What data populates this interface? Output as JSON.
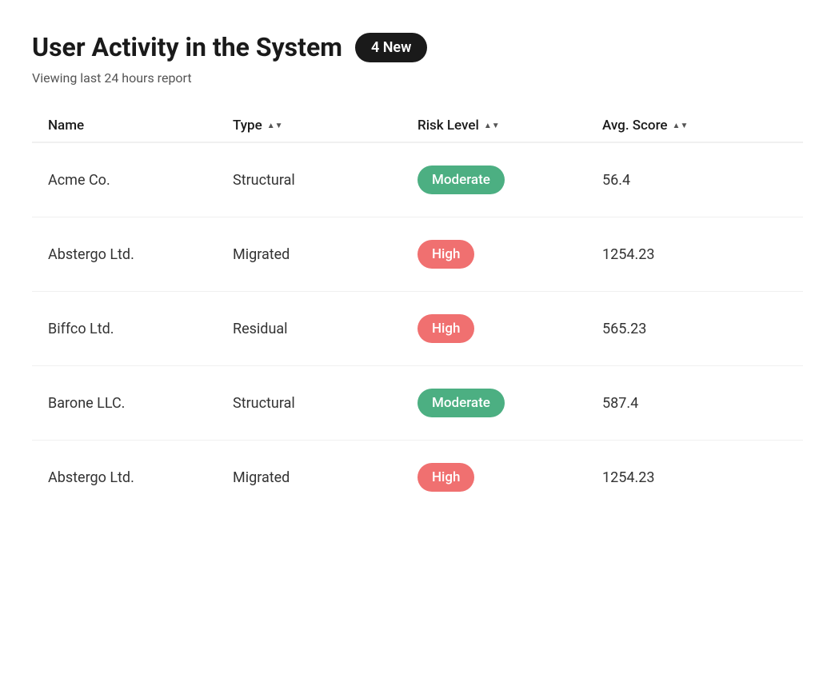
{
  "header": {
    "title": "User Activity in the System",
    "badge": "4 New",
    "subtitle": "Viewing last 24 hours report"
  },
  "table": {
    "columns": [
      {
        "label": "Name",
        "sortable": false
      },
      {
        "label": "Type",
        "sortable": true
      },
      {
        "label": "Risk Level",
        "sortable": true
      },
      {
        "label": "Avg. Score",
        "sortable": true
      }
    ],
    "rows": [
      {
        "name": "Acme Co.",
        "type": "Structural",
        "risk": "Moderate",
        "risk_class": "badge-moderate",
        "score": "56.4"
      },
      {
        "name": "Abstergo Ltd.",
        "type": "Migrated",
        "risk": "High",
        "risk_class": "badge-high",
        "score": "1254.23"
      },
      {
        "name": "Biffco  Ltd.",
        "type": "Residual",
        "risk": "High",
        "risk_class": "badge-high",
        "score": "565.23"
      },
      {
        "name": "Barone LLC.",
        "type": "Structural",
        "risk": "Moderate",
        "risk_class": "badge-moderate",
        "score": "587.4"
      },
      {
        "name": "Abstergo Ltd.",
        "type": "Migrated",
        "risk": "High",
        "risk_class": "badge-high",
        "score": "1254.23"
      }
    ]
  },
  "colors": {
    "badge_bg": "#1a1a1a",
    "moderate_bg": "#4caf82",
    "high_bg": "#f07070"
  }
}
